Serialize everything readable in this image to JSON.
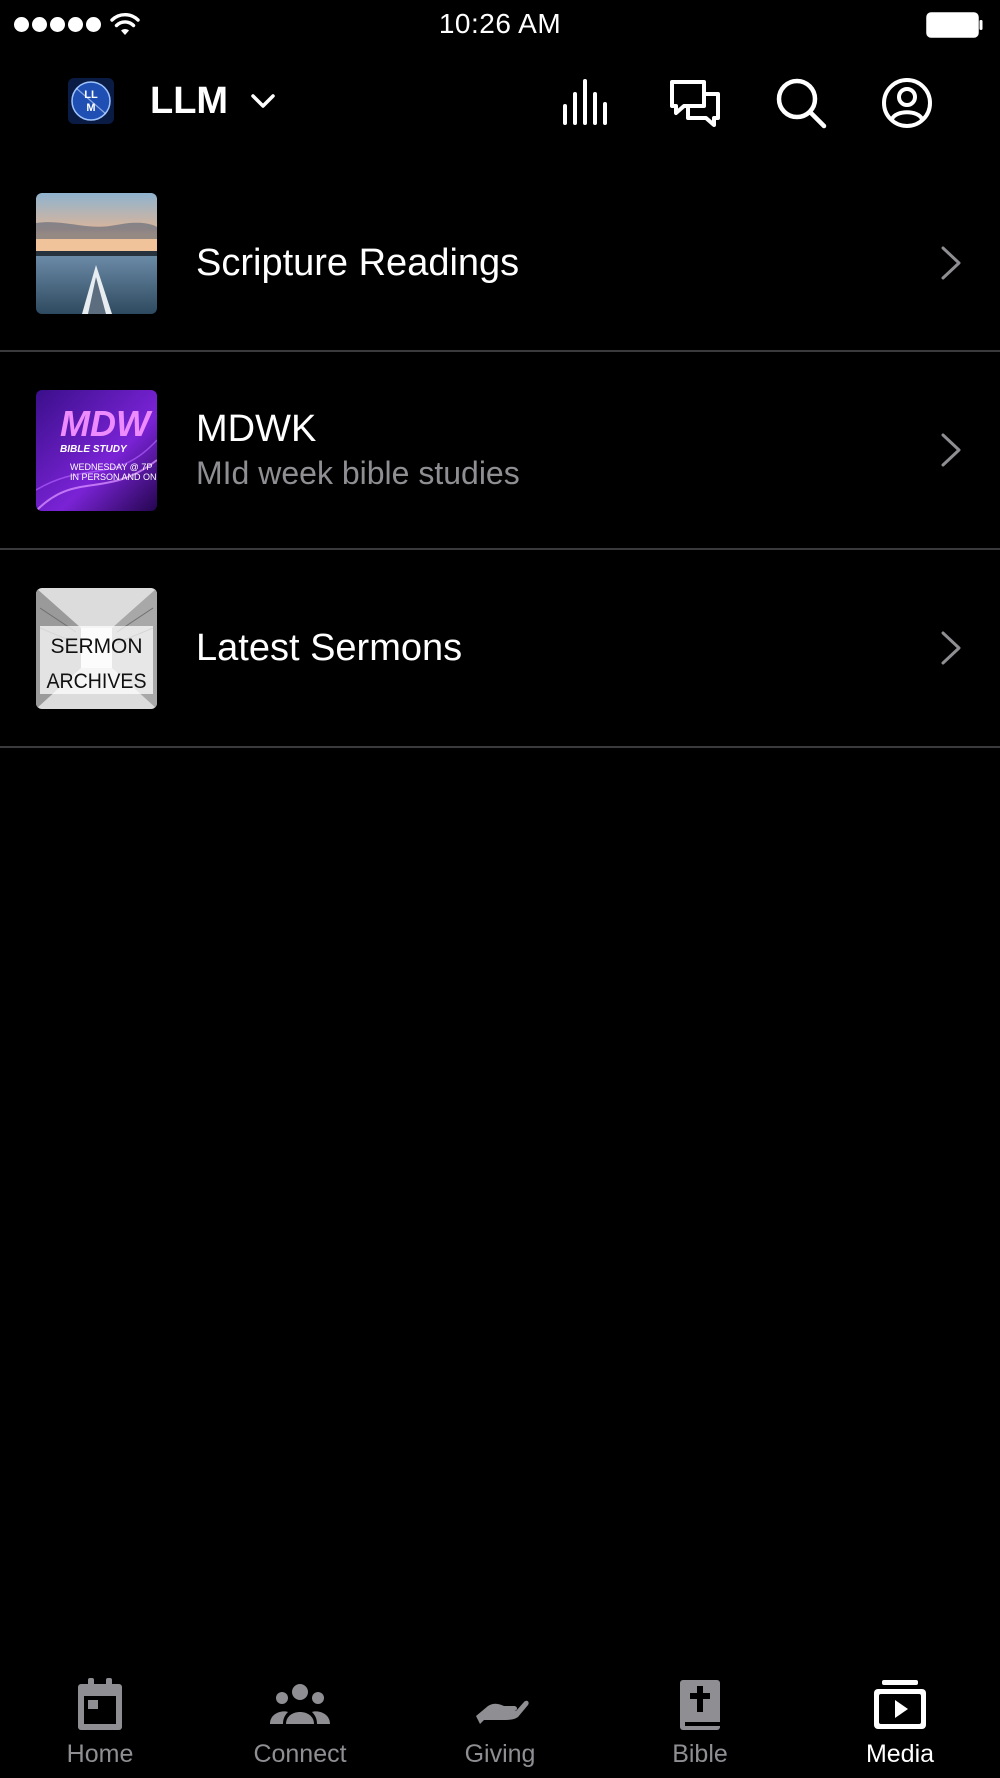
{
  "status_bar": {
    "time": "10:26 AM",
    "signal_icon": "signal-dots-icon",
    "wifi_icon": "wifi-icon",
    "battery_icon": "battery-icon"
  },
  "header": {
    "org_name": "LLM",
    "logo_text": "LLM",
    "icons": [
      "audio-bars-icon",
      "chat-bubbles-icon",
      "search-icon",
      "account-icon"
    ]
  },
  "media_list": [
    {
      "title": "Scripture Readings",
      "subtitle": "",
      "thumbnail": "lake-kayak-photo"
    },
    {
      "title": "MDWK",
      "subtitle": "MId week bible studies",
      "thumbnail": "mdwk-bible-study-art",
      "thumb_text": {
        "big": "MDW",
        "small": "BIBLE STUDY",
        "line1": "WEDNESDAY @ 7P",
        "line2": "IN PERSON AND ON"
      }
    },
    {
      "title": "Latest Sermons",
      "subtitle": "",
      "thumbnail": "sermon-archives-art",
      "thumb_text": {
        "line1": "SERMON",
        "line2": "ARCHIVES"
      }
    }
  ],
  "tabs": [
    {
      "label": "Home",
      "icon": "calendar-icon",
      "active": false
    },
    {
      "label": "Connect",
      "icon": "people-icon",
      "active": false
    },
    {
      "label": "Giving",
      "icon": "giving-hand-icon",
      "active": false
    },
    {
      "label": "Bible",
      "icon": "bible-icon",
      "active": false
    },
    {
      "label": "Media",
      "icon": "media-play-icon",
      "active": true
    }
  ],
  "colors": {
    "background": "#000000",
    "text": "#ffffff",
    "secondary_text": "#8e8e93",
    "divider": "#3a3a3c",
    "active_tab": "#ffffff"
  }
}
